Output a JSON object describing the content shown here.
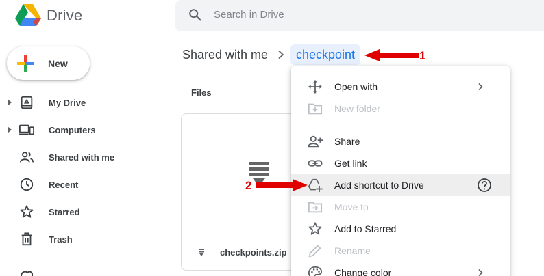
{
  "app": {
    "title": "Drive",
    "logo_icon": "google-drive-logo",
    "colors": {
      "blue": "#4285f4",
      "green": "#0f9d58",
      "yellow": "#f4b400",
      "red": "#db4437",
      "link": "#1a73e8",
      "annotation": "#e00000"
    }
  },
  "search": {
    "placeholder": "Search in Drive",
    "value": "",
    "icon": "search-icon"
  },
  "sidebar": {
    "new_label": "New",
    "items": [
      {
        "label": "My Drive",
        "icon": "my-drive-icon",
        "expandable": true
      },
      {
        "label": "Computers",
        "icon": "computers-icon",
        "expandable": true
      },
      {
        "label": "Shared with me",
        "icon": "shared-with-me-icon",
        "expandable": false
      },
      {
        "label": "Recent",
        "icon": "clock-icon",
        "expandable": false
      },
      {
        "label": "Starred",
        "icon": "star-icon",
        "expandable": false
      },
      {
        "label": "Trash",
        "icon": "trash-icon",
        "expandable": false
      }
    ]
  },
  "breadcrumb": {
    "root": "Shared with me",
    "current": "checkpoint"
  },
  "main": {
    "section_label": "Files",
    "files": [
      {
        "name": "checkpoints.zip",
        "icon": "zip-file-icon"
      }
    ]
  },
  "context_menu": {
    "items": [
      {
        "label": "Open with",
        "icon": "move-arrows-icon",
        "disabled": false,
        "submenu": true
      },
      {
        "label": "New folder",
        "icon": "new-folder-icon",
        "disabled": true
      },
      {
        "label": "Share",
        "icon": "person-add-icon",
        "disabled": false
      },
      {
        "label": "Get link",
        "icon": "link-icon",
        "disabled": false
      },
      {
        "label": "Add shortcut to Drive",
        "icon": "add-shortcut-icon",
        "disabled": false,
        "highlighted": true,
        "help": true
      },
      {
        "label": "Move to",
        "icon": "move-to-icon",
        "disabled": true
      },
      {
        "label": "Add to Starred",
        "icon": "star-icon",
        "disabled": false
      },
      {
        "label": "Rename",
        "icon": "pencil-icon",
        "disabled": true
      },
      {
        "label": "Change color",
        "icon": "palette-icon",
        "disabled": false,
        "submenu": true
      }
    ]
  },
  "annotations": [
    {
      "number": "1",
      "target": "breadcrumb-current"
    },
    {
      "number": "2",
      "target": "menu-item-add-shortcut"
    }
  ]
}
